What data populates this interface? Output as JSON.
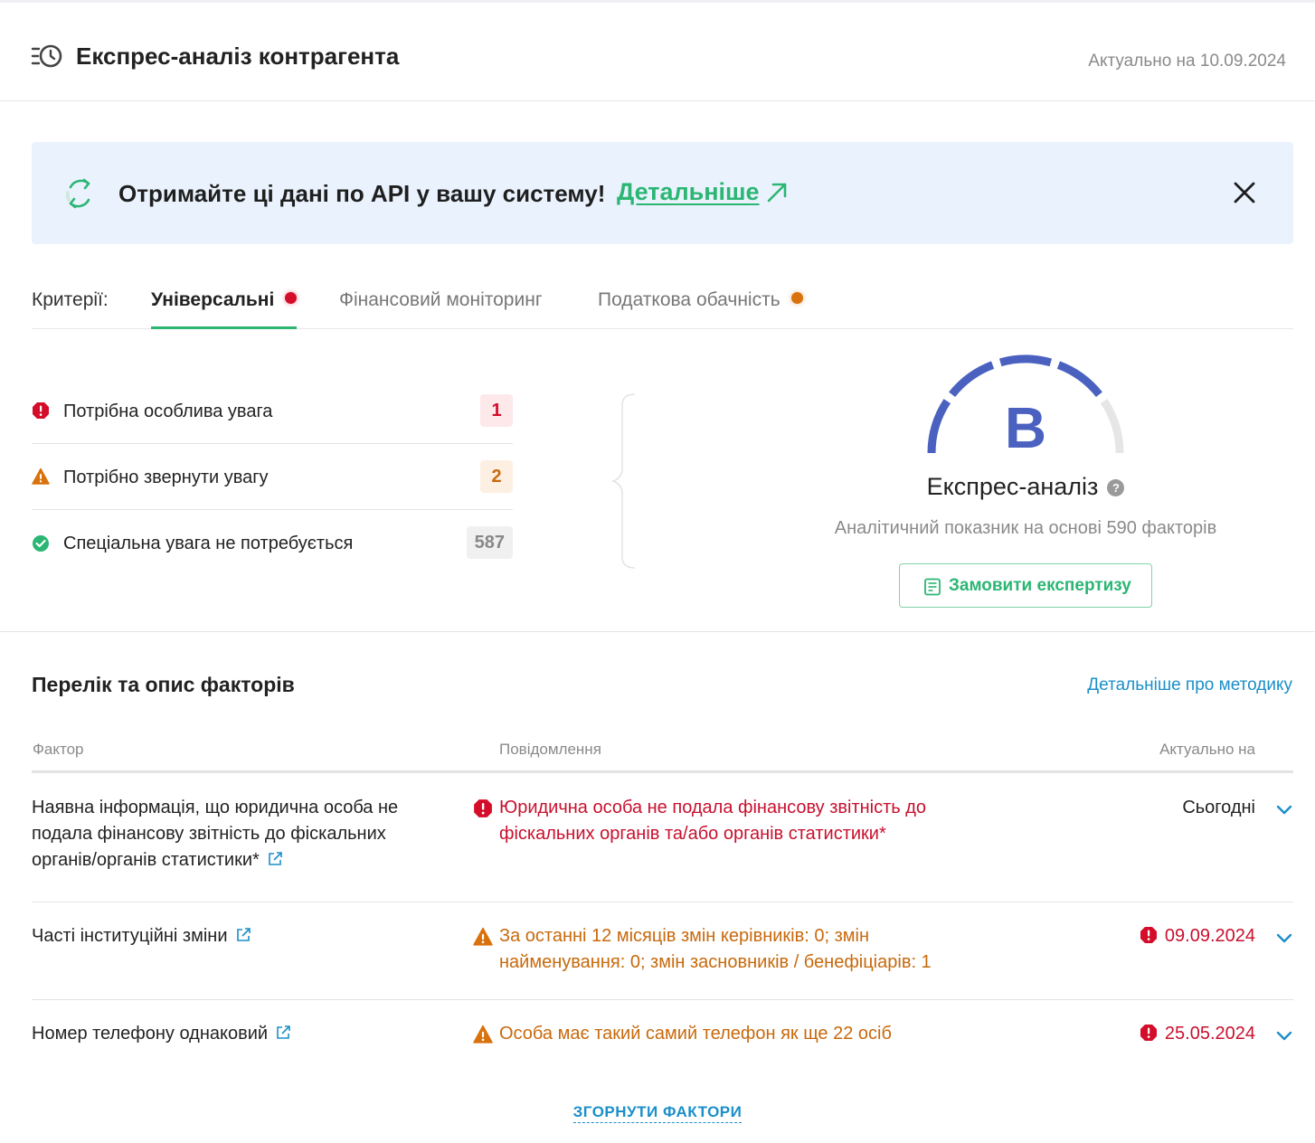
{
  "header": {
    "title": "Експрес-аналіз контрагента",
    "date": "Актуально на 10.09.2024",
    "icon": "history-clock-icon"
  },
  "banner": {
    "text": "Отримайте ці дані по API у вашу систему!",
    "link": "Детальніше",
    "icons": [
      "sync-icon",
      "arrow-up-right-icon",
      "close-icon"
    ]
  },
  "tabs": {
    "criteria_label": "Критерії:",
    "items": [
      {
        "label": "Універсальні",
        "active": true,
        "dot": "red"
      },
      {
        "label": "Фінансовий моніторинг",
        "active": false,
        "dot": null
      },
      {
        "label": "Податкова обачність",
        "active": false,
        "dot": "orange"
      }
    ]
  },
  "summary": [
    {
      "label": "Потрібна особлива увага",
      "count": "1",
      "level": "red",
      "icon": "alert-circle-icon"
    },
    {
      "label": "Потрібно звернути увагу",
      "count": "2",
      "level": "orange",
      "icon": "warning-triangle-icon"
    },
    {
      "label": "Спеціальна увага не потребується",
      "count": "587",
      "level": "gray",
      "icon": "check-circle-icon"
    }
  ],
  "gauge": {
    "grade": "B",
    "title": "Експрес-аналіз",
    "help": "?",
    "subtitle": "Аналітичний показник на основі 590 факторів",
    "button": "Замовити експертизу",
    "filled_segments": 4,
    "total_segments": 5
  },
  "factors": {
    "title": "Перелік та опис факторів",
    "method_link": "Детальніше про методику",
    "columns": [
      "Фактор",
      "Повідомлення",
      "Актуально на"
    ],
    "rows": [
      {
        "factor": "Наявна інформація, що юридична особа не подала фінансову звітність до фіскальних органів/органів статистики*",
        "message": "Юридична особа не подала фінансову звітність до фіскальних органів та/або органів статистики*",
        "level": "red",
        "date": "Сьогодні",
        "date_level": "plain"
      },
      {
        "factor": "Часті інституційні зміни",
        "message": "За останні 12 місяців змін керівників: 0; змін найменування: 0; змін засновників / бенефіціарів: 1",
        "level": "orange",
        "date": "09.09.2024",
        "date_level": "red"
      },
      {
        "factor": "Номер телефону однаковий",
        "message": "Особа має такий самий телефон як ще 22 осіб",
        "level": "orange",
        "date": "25.05.2024",
        "date_level": "red"
      }
    ],
    "collapse": "ЗГОРНУТИ ФАКТОРИ"
  },
  "colors": {
    "green": "#2bb673",
    "red": "#c8102e",
    "orange": "#c8690c",
    "blue_link": "#1a8fc9",
    "gauge_blue": "#4a61c0",
    "banner_bg": "#eaf3fd"
  }
}
